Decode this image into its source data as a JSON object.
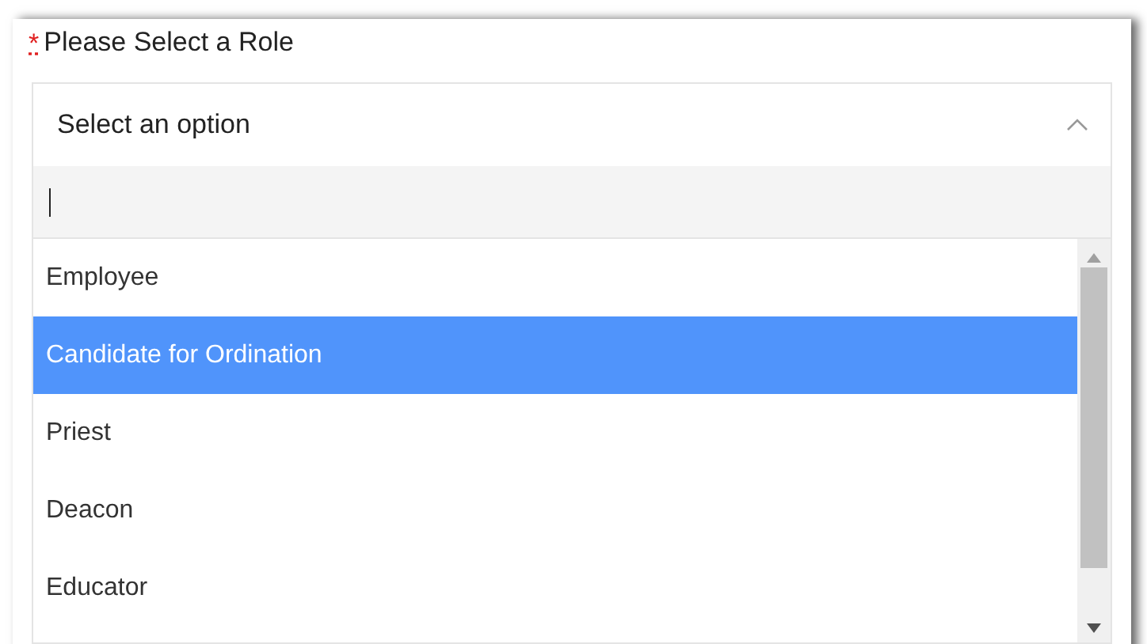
{
  "field": {
    "required_mark": "*",
    "label": "Please Select a Role"
  },
  "select": {
    "placeholder": "Select an option",
    "expanded": true
  },
  "options": [
    {
      "label": "Employee",
      "selected": false
    },
    {
      "label": "Candidate for Ordination",
      "selected": true
    },
    {
      "label": "Priest",
      "selected": false
    },
    {
      "label": "Deacon",
      "selected": false
    },
    {
      "label": "Educator",
      "selected": false
    }
  ]
}
